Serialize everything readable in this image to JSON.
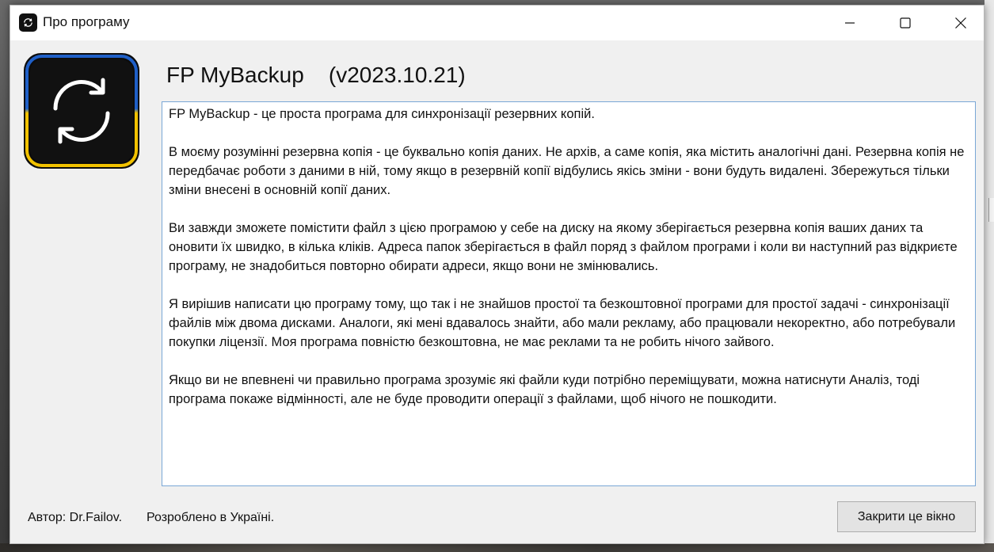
{
  "window": {
    "title": "Про програму"
  },
  "heading": "FP MyBackup    (v2023.10.21)",
  "description": {
    "paragraphs": [
      "FP MyBackup - це проста програма для синхронізації резервних копій.",
      "В моєму розумінні резервна копія - це буквально копія даних. Не архів, а саме копія, яка містить аналогічні дані. Резервна копія не передбачає роботи з даними в ній, тому якщо в резервній копії відбулись якісь зміни - вони будуть видалені. Збережуться тільки зміни внесені в основній копії даних.",
      "Ви завжди зможете помістити файл з цією програмою у себе на диску на якому зберігається резервна копія ваших даних та оновити їх швидко, в кілька кліків. Адреса папок зберігається в файл поряд з файлом програми і коли ви наступний раз відкриєте програму, не знадобиться повторно обирати адреси, якщо вони не змінювались.",
      "Я вирішив написати цю програму тому, що так і не знайшов простої та безкоштовної програми для простої задачі - синхронізації файлів між двома дисками. Аналоги, які мені вдавалось знайти, або мали рекламу, або працювали некоректно, або потребували покупки ліцензії. Моя програма повністю безкоштовна, не має реклами та не робить нічого зайвого.",
      "Якщо ви не впевнені чи правильно програма зрозуміє які файли куди потрібно переміщувати, можна натиснути Аналіз, тоді програма покаже відмінності, але не буде проводити операції з файлами, щоб нічого не пошкодити."
    ]
  },
  "footer": {
    "author": "Автор: Dr.Failov.",
    "made_in": "Розроблено в Україні.",
    "close_button": "Закрити це вікно"
  },
  "icons": {
    "app": "sync-icon",
    "logo": "sync-logo-icon",
    "minimize": "minimize-icon",
    "maximize": "maximize-icon",
    "close": "close-icon"
  },
  "colors": {
    "logo_top": "#1f5fc7",
    "logo_bottom": "#f2c200",
    "textbox_border": "#7aa7d6"
  }
}
